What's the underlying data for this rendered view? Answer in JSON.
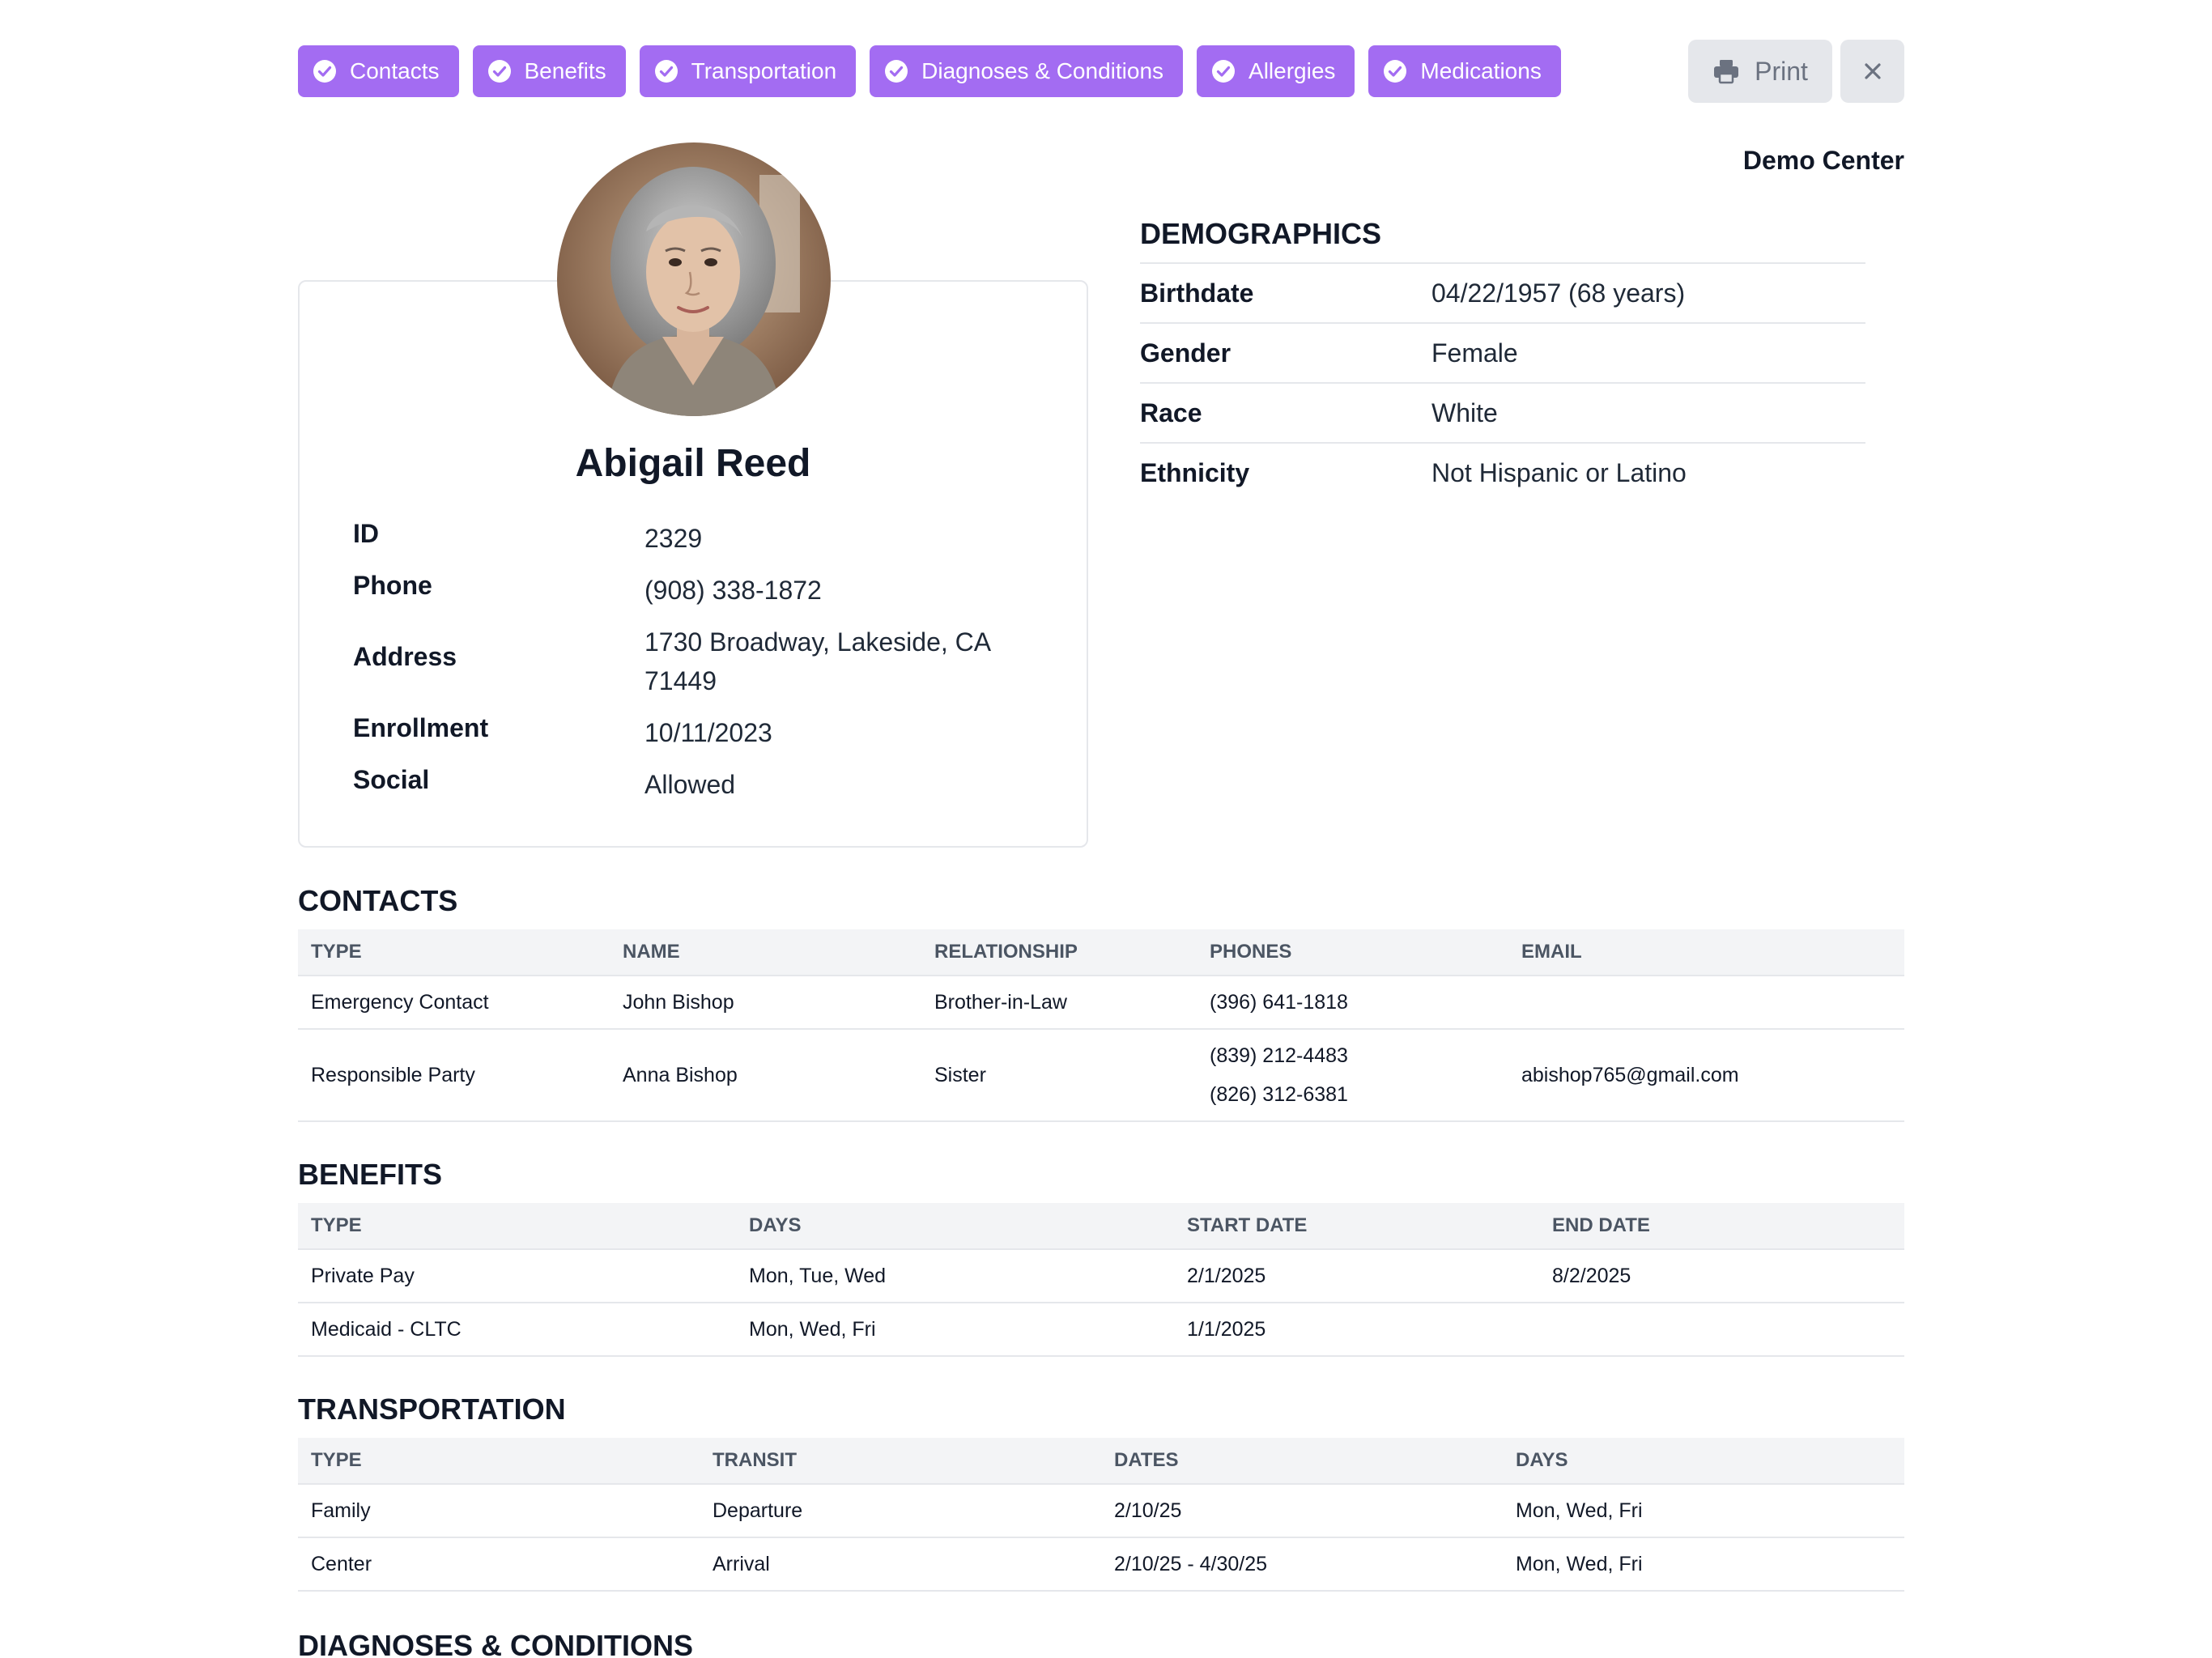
{
  "nav": {
    "chips": [
      {
        "label": "Contacts"
      },
      {
        "label": "Benefits"
      },
      {
        "label": "Transportation"
      },
      {
        "label": "Diagnoses & Conditions"
      },
      {
        "label": "Allergies"
      },
      {
        "label": "Medications"
      }
    ],
    "print_label": "Print",
    "accent_color": "#a36cf2"
  },
  "center": "Demo Center",
  "profile": {
    "name": "Abigail Reed",
    "fields": [
      {
        "label": "ID",
        "value": "2329"
      },
      {
        "label": "Phone",
        "value": "(908) 338-1872"
      },
      {
        "label": "Address",
        "value": "1730 Broadway, Lakeside, CA 71449"
      },
      {
        "label": "Enrollment",
        "value": "10/11/2023"
      },
      {
        "label": "Social",
        "value": "Allowed"
      }
    ]
  },
  "demographics": {
    "title": "DEMOGRAPHICS",
    "rows": [
      {
        "label": "Birthdate",
        "value": "04/22/1957 (68 years)"
      },
      {
        "label": "Gender",
        "value": "Female"
      },
      {
        "label": "Race",
        "value": "White"
      },
      {
        "label": "Ethnicity",
        "value": "Not Hispanic or Latino"
      }
    ]
  },
  "contacts": {
    "title": "CONTACTS",
    "columns": [
      "TYPE",
      "NAME",
      "RELATIONSHIP",
      "PHONES",
      "EMAIL"
    ],
    "rows": [
      {
        "type": "Emergency Contact",
        "name": "John Bishop",
        "relationship": "Brother-in-Law",
        "phones": [
          "(396) 641-1818"
        ],
        "email": ""
      },
      {
        "type": "Responsible Party",
        "name": "Anna Bishop",
        "relationship": "Sister",
        "phones": [
          "(839) 212-4483",
          "(826) 312-6381"
        ],
        "email": "abishop765@gmail.com"
      }
    ]
  },
  "benefits": {
    "title": "BENEFITS",
    "columns": [
      "TYPE",
      "DAYS",
      "START DATE",
      "END DATE"
    ],
    "rows": [
      {
        "type": "Private Pay",
        "days": "Mon, Tue, Wed",
        "start": "2/1/2025",
        "end": "8/2/2025"
      },
      {
        "type": "Medicaid - CLTC",
        "days": "Mon, Wed, Fri",
        "start": "1/1/2025",
        "end": ""
      }
    ]
  },
  "transportation": {
    "title": "TRANSPORTATION",
    "columns": [
      "TYPE",
      "TRANSIT",
      "DATES",
      "DAYS"
    ],
    "rows": [
      {
        "type": "Family",
        "transit": "Departure",
        "dates": "2/10/25",
        "days": "Mon, Wed, Fri"
      },
      {
        "type": "Center",
        "transit": "Arrival",
        "dates": "2/10/25 - 4/30/25",
        "days": "Mon, Wed, Fri"
      }
    ]
  },
  "diagnoses": {
    "title": "DIAGNOSES & CONDITIONS"
  }
}
